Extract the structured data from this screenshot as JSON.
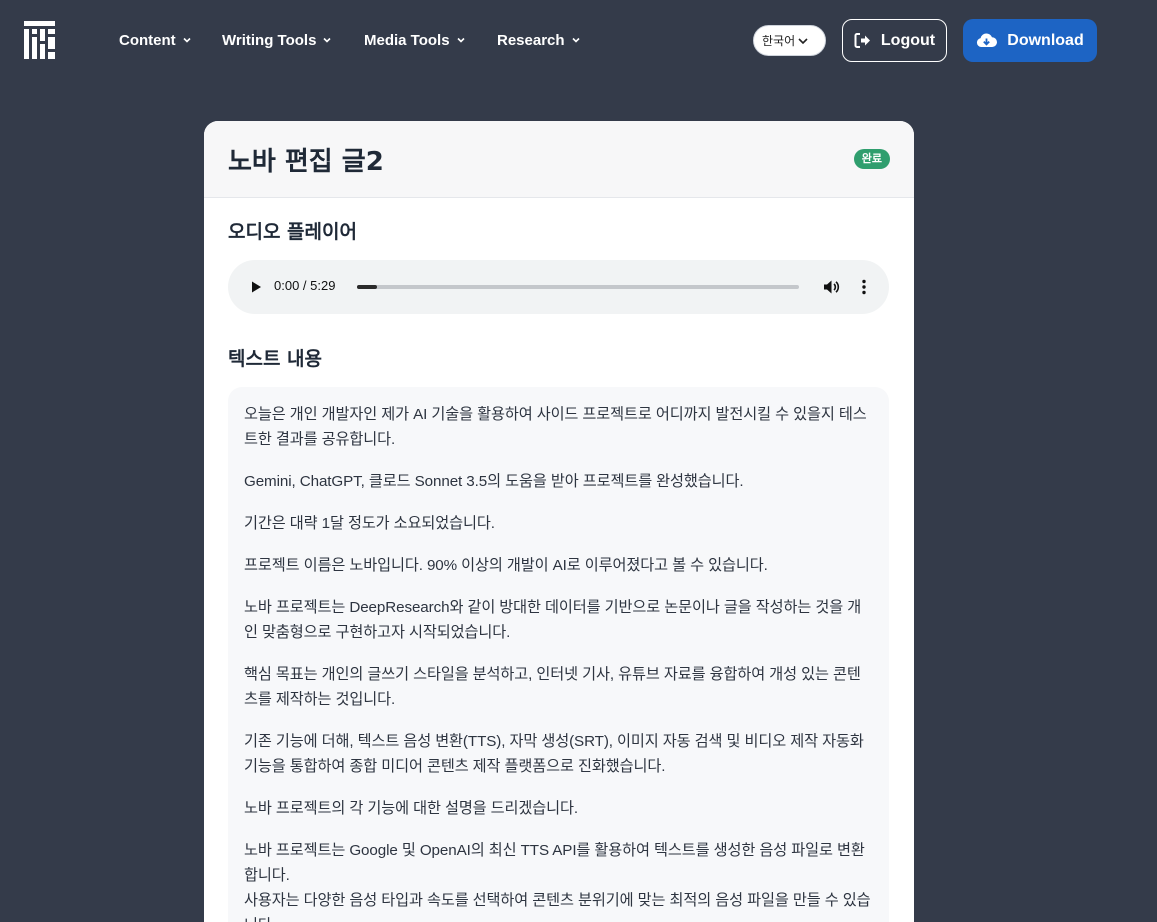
{
  "nav": {
    "items": [
      {
        "label": "Content"
      },
      {
        "label": "Writing Tools"
      },
      {
        "label": "Media Tools"
      },
      {
        "label": "Research"
      }
    ],
    "language": "한국어",
    "logout_label": "Logout",
    "download_label": "Download"
  },
  "card": {
    "title": "노바 편집 글2",
    "status_badge": "완료",
    "audio_section_title": "오디오 플레이어",
    "audio": {
      "time": "0:00 / 5:29",
      "progress": 0.0
    },
    "text_section_title": "텍스트 내용",
    "paragraphs": [
      "오늘은 개인 개발자인 제가 AI 기술을 활용하여 사이드 프로젝트로 어디까지 발전시킬 수 있을지 테스트한 결과를 공유합니다.",
      "Gemini, ChatGPT, 클로드 Sonnet 3.5의 도움을 받아 프로젝트를 완성했습니다.",
      "기간은 대략 1달 정도가 소요되었습니다.",
      "프로젝트 이름은 노바입니다. 90% 이상의 개발이 AI로 이루어졌다고 볼 수 있습니다.",
      "노바 프로젝트는 DeepResearch와 같이 방대한 데이터를 기반으로 논문이나 글을 작성하는 것을 개인 맞춤형으로 구현하고자 시작되었습니다.",
      "핵심 목표는 개인의 글쓰기 스타일을 분석하고, 인터넷 기사, 유튜브 자료를 융합하여 개성 있는 콘텐츠를 제작하는 것입니다.",
      "기존 기능에 더해, 텍스트 음성 변환(TTS), 자막 생성(SRT), 이미지 자동 검색 및 비디오 제작 자동화 기능을 통합하여 종합 미디어 콘텐츠 제작 플랫폼으로 진화했습니다.",
      "노바 프로젝트의 각 기능에 대한 설명을 드리겠습니다.",
      "노바 프로젝트는 Google 및 OpenAI의 최신 TTS API를 활용하여 텍스트를 생성한 음성 파일로 변환합니다.",
      "사용자는 다양한 음성 타입과 속도를 선택하여 콘텐츠 분위기에 맞는 최적의 음성 파일을 만들 수 있습니다."
    ]
  }
}
